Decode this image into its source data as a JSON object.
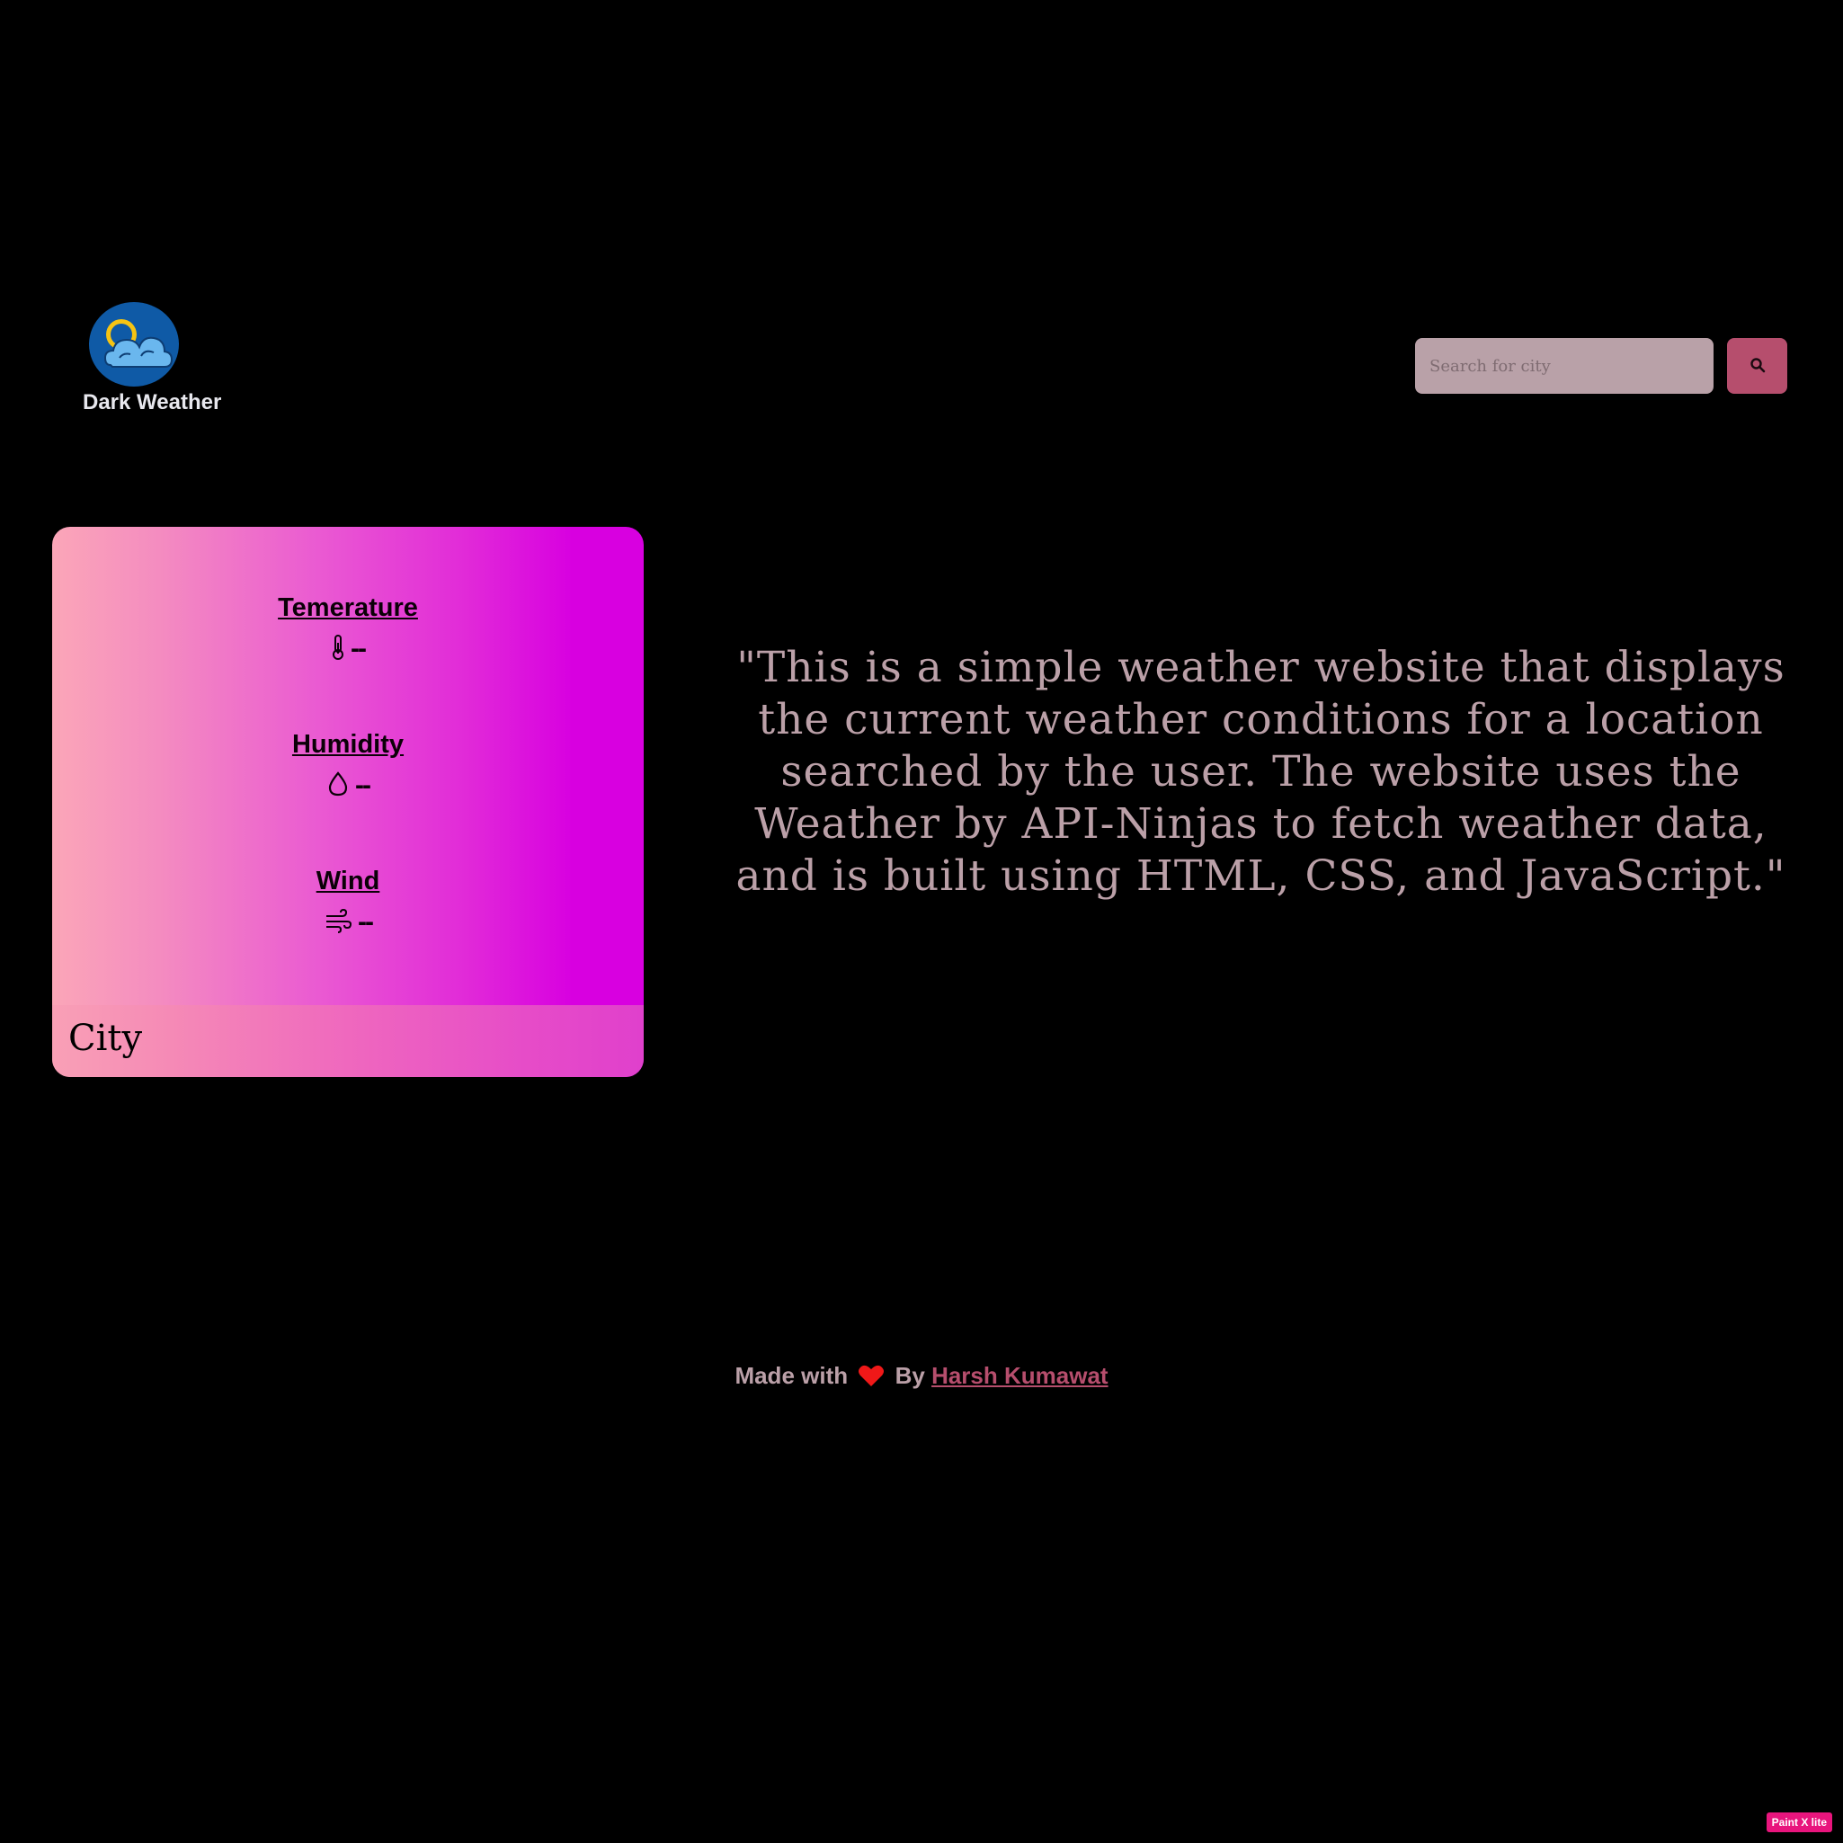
{
  "header": {
    "logo_text": "Dark Weather",
    "search": {
      "placeholder": "Search for city",
      "value": ""
    }
  },
  "card": {
    "metrics": [
      {
        "label": "Temerature",
        "value": "--",
        "icon": "thermometer-icon"
      },
      {
        "label": "Humidity",
        "value": "--",
        "icon": "droplet-icon"
      },
      {
        "label": "Wind",
        "value": "--",
        "icon": "wind-icon"
      }
    ],
    "city": "City"
  },
  "description": "\"This is a simple weather website that displays the current weather conditions for a location searched by the user. The website uses the Weather by API-Ninjas to fetch weather data, and is built using HTML, CSS, and JavaScript.\"",
  "footer": {
    "prefix": "Made with",
    "by": "By",
    "author": "Harsh Kumawat"
  },
  "watermark": "Paint X lite",
  "colors": {
    "background": "#000000",
    "accent": "#b64e6d",
    "text_muted": "#bba0a8",
    "card_gradient_start": "#fba6b8",
    "card_gradient_end": "#d800e0"
  }
}
